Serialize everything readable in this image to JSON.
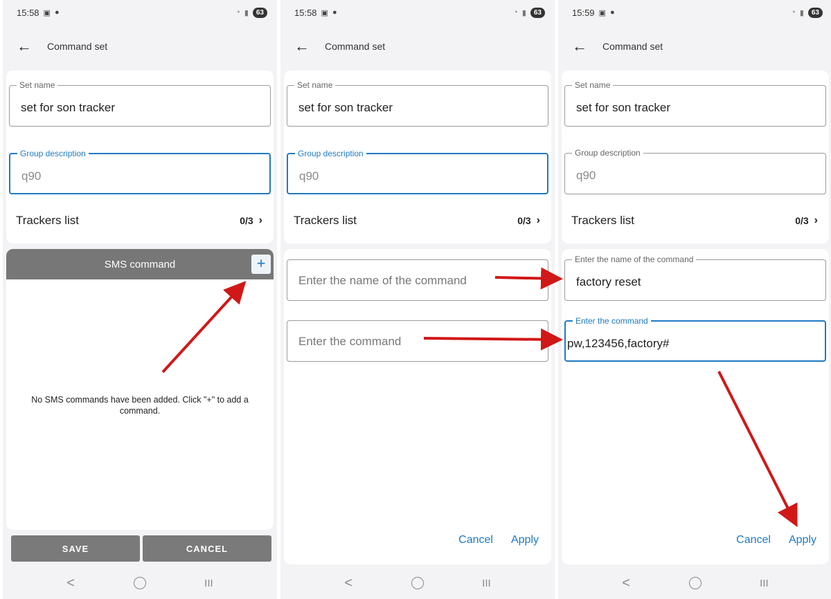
{
  "panels": [
    {
      "time": "15:58",
      "title": "Command set",
      "set_name_label": "Set name",
      "set_name_value": "set for son tracker",
      "group_desc_label": "Group description",
      "group_desc_value": "q90",
      "trackers_label": "Trackers list",
      "trackers_count": "0/3",
      "sms_header": "SMS command",
      "add_glyph": "+",
      "empty_message": "No SMS commands have been added. Click \"+\" to add a command.",
      "save_label": "SAVE",
      "cancel_label": "CANCEL"
    },
    {
      "time": "15:58",
      "title": "Command set",
      "set_name_label": "Set name",
      "set_name_value": "set for son tracker",
      "group_desc_label": "Group description",
      "group_desc_value": "q90",
      "trackers_label": "Trackers list",
      "trackers_count": "0/3",
      "cmd_name_placeholder": "Enter the name of the command",
      "cmd_placeholder": "Enter the command",
      "cancel_label": "Cancel",
      "apply_label": "Apply"
    },
    {
      "time": "15:59",
      "title": "Command set",
      "set_name_label": "Set name",
      "set_name_value": "set for son tracker",
      "group_desc_label": "Group description",
      "group_desc_value": "q90",
      "trackers_label": "Trackers list",
      "trackers_count": "0/3",
      "cmd_name_label": "Enter the name of the command",
      "cmd_name_value": "factory reset",
      "cmd_label": "Enter the command",
      "cmd_value": "pw,123456,factory#",
      "cancel_label": "Cancel",
      "apply_label": "Apply"
    }
  ],
  "status": {
    "battery": "63"
  },
  "icons": {
    "back": "←",
    "chevron": "›",
    "nav_back": "<",
    "nav_recent": "III",
    "status_left": [
      "screenshot-icon",
      "bag-icon"
    ],
    "status_right": [
      "wifi-icon",
      "signal-icon"
    ],
    "nav": [
      "nav-back-icon",
      "nav-home-icon",
      "nav-recent-icon"
    ]
  },
  "colors": {
    "accent": "#1f7ac4",
    "arrow": "#d01818",
    "header_gray": "#777777"
  }
}
